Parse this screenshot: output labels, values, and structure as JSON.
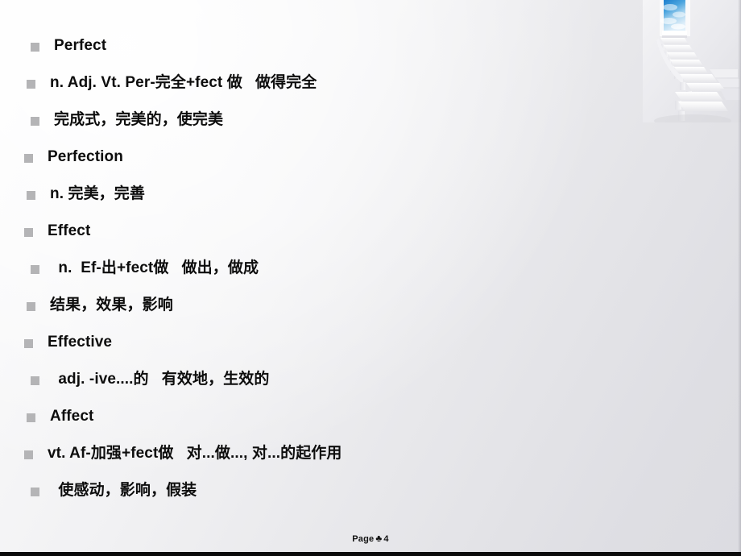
{
  "slide": {
    "page_number": "4",
    "footer": {
      "prefix": "Page",
      "glyph": "♣",
      "number": "4"
    },
    "background": {
      "base_color": "#eeeef1",
      "highlight_color": "#fbfbfc",
      "shadow_color": "#dcdce1",
      "bottom_band_color": "#0a0a0a"
    },
    "bullet_color": "#b4b4b6",
    "text_color": "#0d0d0d",
    "bullets": [
      {
        "text": "Perfect"
      },
      {
        "text": "n. Adj. Vt. Per-完全+fect 做   做得完全"
      },
      {
        "text": "完成式，完美的，使完美"
      },
      {
        "text": "Perfection"
      },
      {
        "text": "n. 完美，完善"
      },
      {
        "text": "Effect"
      },
      {
        "text": " n.  Ef-出+fect做   做出，做成"
      },
      {
        "text": "结果，效果，影响"
      },
      {
        "text": "Effective"
      },
      {
        "text": " adj. -ive....的   有效地，生效的"
      },
      {
        "text": "Affect"
      },
      {
        "text": "vt. Af-加强+fect做   对...做..., 对...的起作用"
      },
      {
        "text": " 使感动，影响，假装"
      }
    ],
    "decoration": {
      "name": "white-staircase-with-blue-doorway",
      "doorway_color": "#2f8fd8",
      "sky_color": "#cfe6f7",
      "stair_color": "#ffffff"
    }
  }
}
